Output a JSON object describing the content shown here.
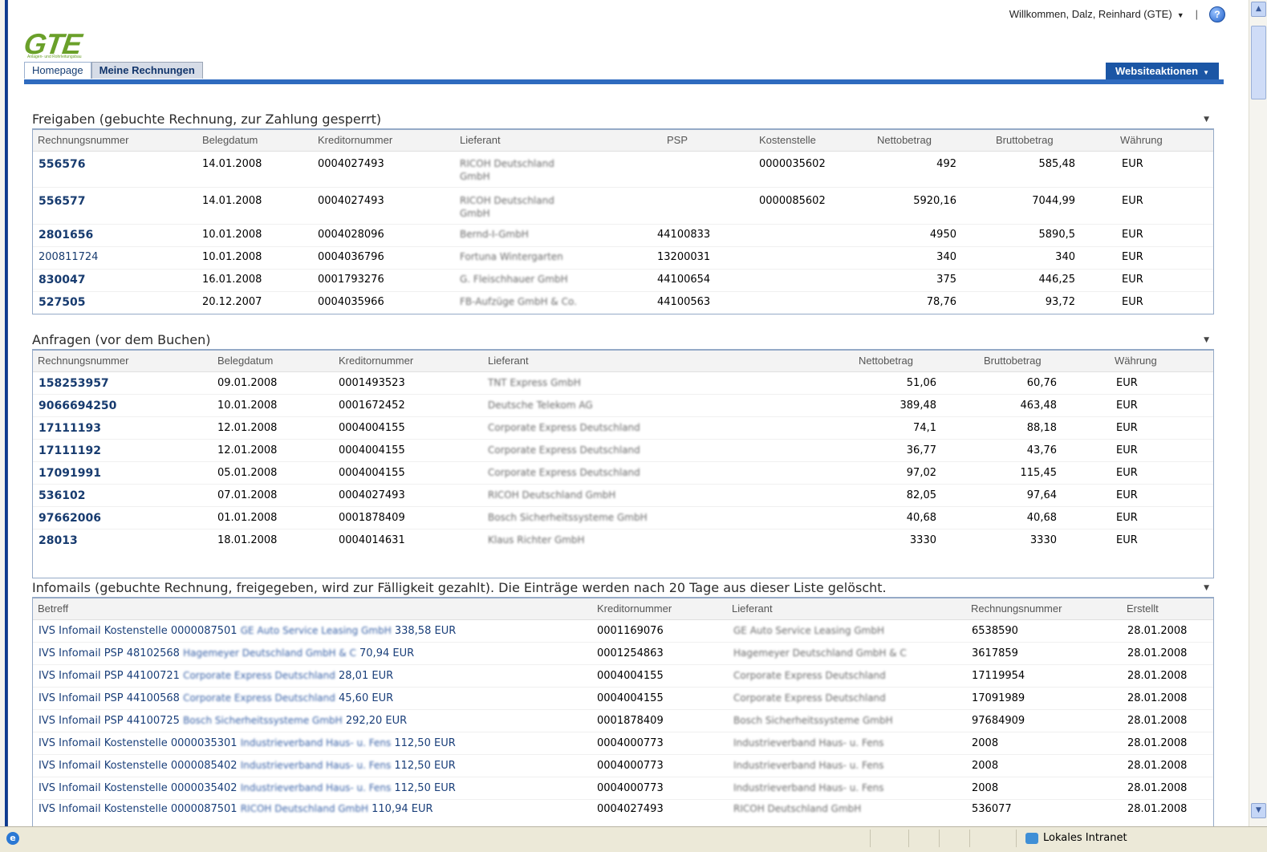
{
  "topbar": {
    "welcome": "Willkommen, Dalz, Reinhard (GTE)",
    "help_icon": "help-icon"
  },
  "logo": {
    "text": "GTE",
    "subtext": "Anlagen- und Rohrleitungsbau"
  },
  "tabs": [
    {
      "label": "Homepage"
    },
    {
      "label": "Meine Rechnungen"
    }
  ],
  "site_actions": {
    "label": "Websiteaktionen"
  },
  "freigaben": {
    "title": "Freigaben (gebuchte Rechnung, zur Zahlung gesperrt)",
    "columns": [
      "Rechnungsnummer",
      "Belegdatum",
      "Kreditornummer",
      "Lieferant",
      "PSP",
      "Kostenstelle",
      "Nettobetrag",
      "Bruttobetrag",
      "Währung"
    ],
    "rows": [
      {
        "nr": "556576",
        "datum": "14.01.2008",
        "kred": "0004027493",
        "lief1": "RICOH Deutschland",
        "lief2": "GmbH",
        "psp": "",
        "kst": "0000035602",
        "netto": "492",
        "brutto": "585,48",
        "waehrung": "EUR",
        "bold": true
      },
      {
        "nr": "556577",
        "datum": "14.01.2008",
        "kred": "0004027493",
        "lief1": "RICOH Deutschland",
        "lief2": "GmbH",
        "psp": "",
        "kst": "0000085602",
        "netto": "5920,16",
        "brutto": "7044,99",
        "waehrung": "EUR",
        "bold": true
      },
      {
        "nr": "2801656",
        "datum": "10.01.2008",
        "kred": "0004028096",
        "lief1": "Bernd-I-GmbH",
        "lief2": "",
        "psp": "44100833",
        "kst": "",
        "netto": "4950",
        "brutto": "5890,5",
        "waehrung": "EUR",
        "bold": true
      },
      {
        "nr": "200811724",
        "datum": "10.01.2008",
        "kred": "0004036796",
        "lief1": "Fortuna Wintergarten",
        "lief2": "",
        "psp": "13200031",
        "kst": "",
        "netto": "340",
        "brutto": "340",
        "waehrung": "EUR",
        "bold": false
      },
      {
        "nr": "830047",
        "datum": "16.01.2008",
        "kred": "0001793276",
        "lief1": "G. Fleischhauer GmbH",
        "lief2": "",
        "psp": "44100654",
        "kst": "",
        "netto": "375",
        "brutto": "446,25",
        "waehrung": "EUR",
        "bold": true
      },
      {
        "nr": "527505",
        "datum": "20.12.2007",
        "kred": "0004035966",
        "lief1": "FB-Aufzüge GmbH & Co.",
        "lief2": "",
        "psp": "44100563",
        "kst": "",
        "netto": "78,76",
        "brutto": "93,72",
        "waehrung": "EUR",
        "bold": true
      }
    ]
  },
  "anfragen": {
    "title": "Anfragen (vor dem Buchen)",
    "columns": [
      "Rechnungsnummer",
      "Belegdatum",
      "Kreditornummer",
      "Lieferant",
      "Nettobetrag",
      "Bruttobetrag",
      "Währung"
    ],
    "rows": [
      {
        "nr": "158253957",
        "datum": "09.01.2008",
        "kred": "0001493523",
        "lief": "TNT Express GmbH",
        "netto": "51,06",
        "brutto": "60,76",
        "waehrung": "EUR"
      },
      {
        "nr": "9066694250",
        "datum": "10.01.2008",
        "kred": "0001672452",
        "lief": "Deutsche Telekom AG",
        "netto": "389,48",
        "brutto": "463,48",
        "waehrung": "EUR"
      },
      {
        "nr": "17111193",
        "datum": "12.01.2008",
        "kred": "0004004155",
        "lief": "Corporate Express Deutschland",
        "netto": "74,1",
        "brutto": "88,18",
        "waehrung": "EUR"
      },
      {
        "nr": "17111192",
        "datum": "12.01.2008",
        "kred": "0004004155",
        "lief": "Corporate Express Deutschland",
        "netto": "36,77",
        "brutto": "43,76",
        "waehrung": "EUR"
      },
      {
        "nr": "17091991",
        "datum": "05.01.2008",
        "kred": "0004004155",
        "lief": "Corporate Express Deutschland",
        "netto": "97,02",
        "brutto": "115,45",
        "waehrung": "EUR"
      },
      {
        "nr": "536102",
        "datum": "07.01.2008",
        "kred": "0004027493",
        "lief": "RICOH Deutschland GmbH",
        "netto": "82,05",
        "brutto": "97,64",
        "waehrung": "EUR"
      },
      {
        "nr": "97662006",
        "datum": "01.01.2008",
        "kred": "0001878409",
        "lief": "Bosch Sicherheitssysteme GmbH",
        "netto": "40,68",
        "brutto": "40,68",
        "waehrung": "EUR"
      },
      {
        "nr": "28013",
        "datum": "18.01.2008",
        "kred": "0004014631",
        "lief": "Klaus Richter GmbH",
        "netto": "3330",
        "brutto": "3330",
        "waehrung": "EUR"
      }
    ]
  },
  "infomails": {
    "title": "Infomails (gebuchte Rechnung, freigegeben, wird zur Fälligkeit gezahlt). Die Einträge werden nach 20 Tage aus dieser Liste gelöscht.",
    "columns": [
      "Betreff",
      "Kreditornummer",
      "Lieferant",
      "Rechnungsnummer",
      "Erstellt"
    ],
    "rows": [
      {
        "pre": "IVS Infomail Kostenstelle 0000087501",
        "mid": "GE Auto Service Leasing GmbH",
        "post": "338,58 EUR",
        "kred": "0001169076",
        "lief": "GE Auto Service Leasing GmbH",
        "nr": "6538590",
        "erstellt": "28.01.2008"
      },
      {
        "pre": "IVS Infomail PSP 48102568",
        "mid": "Hagemeyer Deutschland GmbH & C",
        "post": "70,94 EUR",
        "kred": "0001254863",
        "lief": "Hagemeyer Deutschland GmbH & C",
        "nr": "3617859",
        "erstellt": "28.01.2008"
      },
      {
        "pre": "IVS Infomail PSP 44100721",
        "mid": "Corporate Express Deutschland",
        "post": "28,01 EUR",
        "kred": "0004004155",
        "lief": "Corporate Express Deutschland",
        "nr": "17119954",
        "erstellt": "28.01.2008"
      },
      {
        "pre": "IVS Infomail PSP 44100568",
        "mid": "Corporate Express Deutschland",
        "post": "45,60 EUR",
        "kred": "0004004155",
        "lief": "Corporate Express Deutschland",
        "nr": "17091989",
        "erstellt": "28.01.2008"
      },
      {
        "pre": "IVS Infomail PSP 44100725",
        "mid": "Bosch Sicherheitssysteme GmbH",
        "post": "292,20 EUR",
        "kred": "0001878409",
        "lief": "Bosch Sicherheitssysteme GmbH",
        "nr": "97684909",
        "erstellt": "28.01.2008"
      },
      {
        "pre": "IVS Infomail Kostenstelle 0000035301",
        "mid": "Industrieverband Haus- u. Fens",
        "post": "112,50 EUR",
        "kred": "0004000773",
        "lief": "Industrieverband Haus- u. Fens",
        "nr": "2008",
        "erstellt": "28.01.2008"
      },
      {
        "pre": "IVS Infomail Kostenstelle 0000085402",
        "mid": "Industrieverband Haus- u. Fens",
        "post": "112,50 EUR",
        "kred": "0004000773",
        "lief": "Industrieverband Haus- u. Fens",
        "nr": "2008",
        "erstellt": "28.01.2008"
      },
      {
        "pre": "IVS Infomail Kostenstelle 0000035402",
        "mid": "Industrieverband Haus- u. Fens",
        "post": "112,50 EUR",
        "kred": "0004000773",
        "lief": "Industrieverband Haus- u. Fens",
        "nr": "2008",
        "erstellt": "28.01.2008"
      },
      {
        "pre": "IVS Infomail Kostenstelle 0000087501",
        "mid": "RICOH Deutschland GmbH",
        "post": "110,94 EUR",
        "kred": "0004027493",
        "lief": "RICOH Deutschland GmbH",
        "nr": "536077",
        "erstellt": "28.01.2008"
      }
    ]
  },
  "statusbar": {
    "zone": "Lokales Intranet"
  }
}
